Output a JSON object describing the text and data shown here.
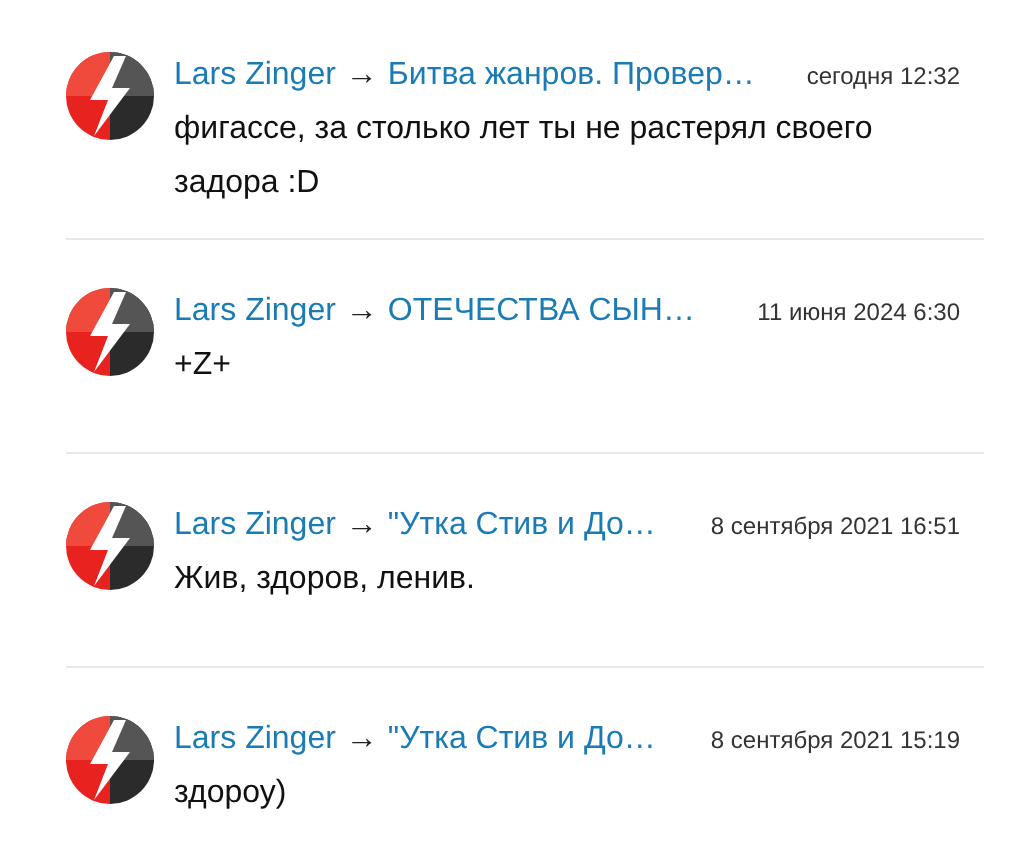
{
  "comments": [
    {
      "author": "Lars Zinger",
      "separator": "→",
      "topic": "Битва жанров. Провер…",
      "date": "сегодня 12:32",
      "text": "фигассе, за столько лет ты не растерял своего задора :D"
    },
    {
      "author": "Lars Zinger",
      "separator": "→",
      "topic": "ОТЕЧЕСТВА СЫН…",
      "date": "11 июня 2024 6:30",
      "text": "+Z+"
    },
    {
      "author": "Lars Zinger",
      "separator": "→",
      "topic": "\"Утка Стив и До…",
      "date": "8 сентября 2021 16:51",
      "text": "Жив, здоров, ленив."
    },
    {
      "author": "Lars Zinger",
      "separator": "→",
      "topic": "\"Утка Стив и До…",
      "date": "8 сентября 2021 15:19",
      "text": "здороу)"
    }
  ]
}
